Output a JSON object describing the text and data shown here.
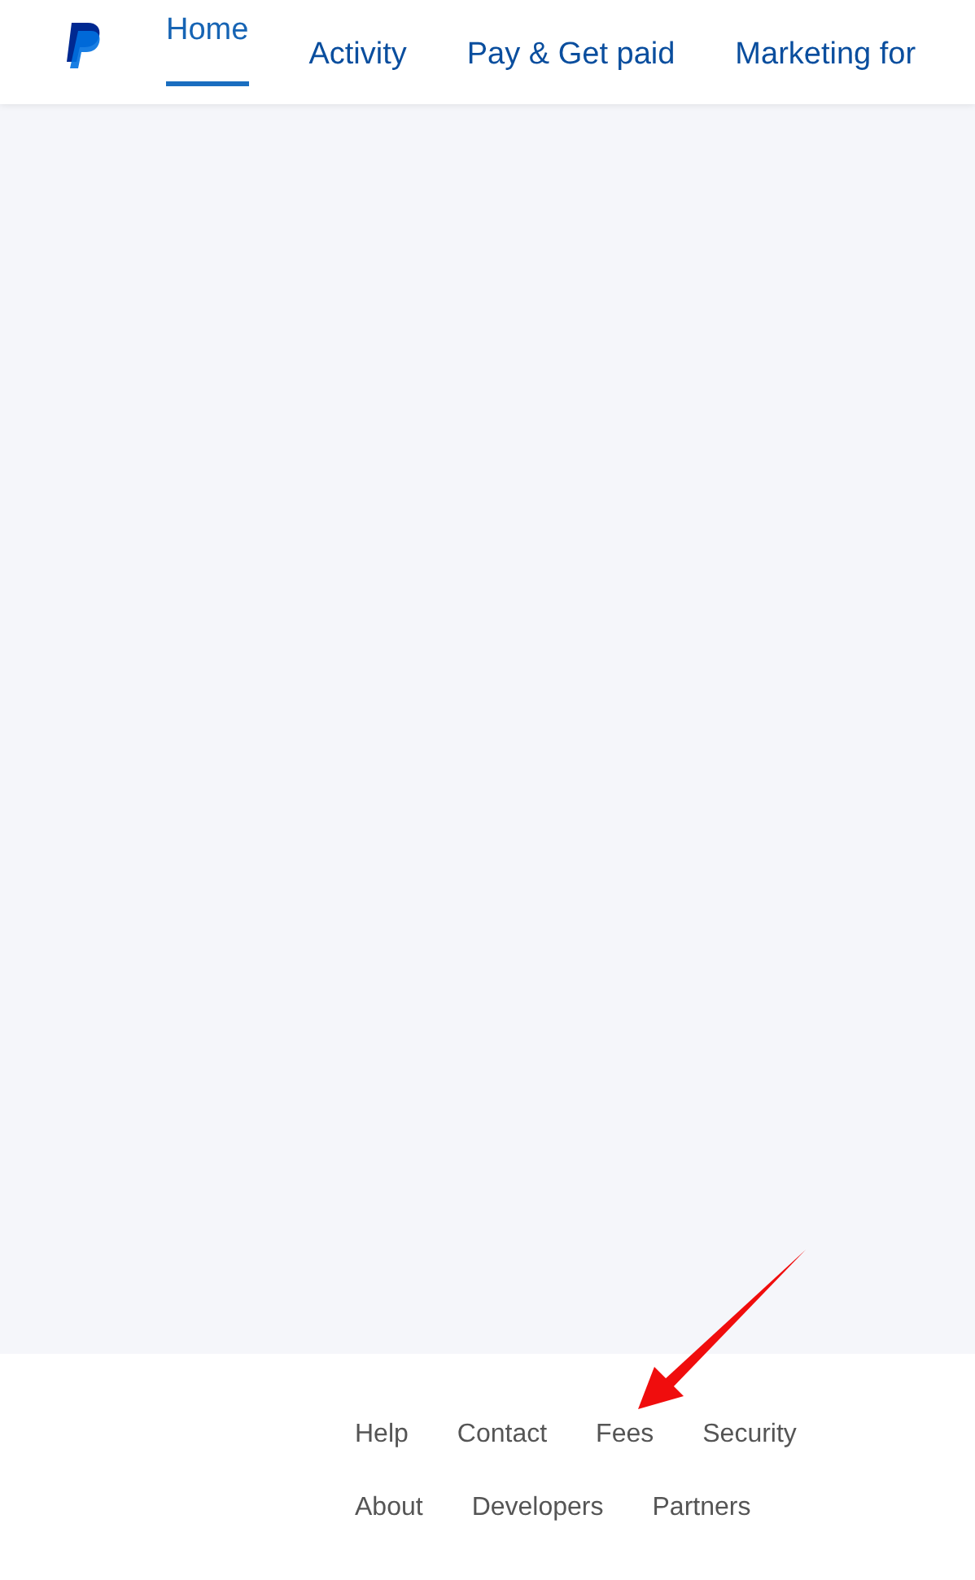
{
  "nav": {
    "tabs": [
      {
        "label": "Home",
        "selected": true
      },
      {
        "label": "Activity",
        "selected": false
      },
      {
        "label": "Pay & Get paid",
        "selected": false
      },
      {
        "label": "Marketing for",
        "selected": false
      }
    ]
  },
  "footer": {
    "link_rows": [
      [
        "Help",
        "Contact",
        "Fees",
        "Security"
      ],
      [
        "About",
        "Developers",
        "Partners"
      ]
    ]
  }
}
